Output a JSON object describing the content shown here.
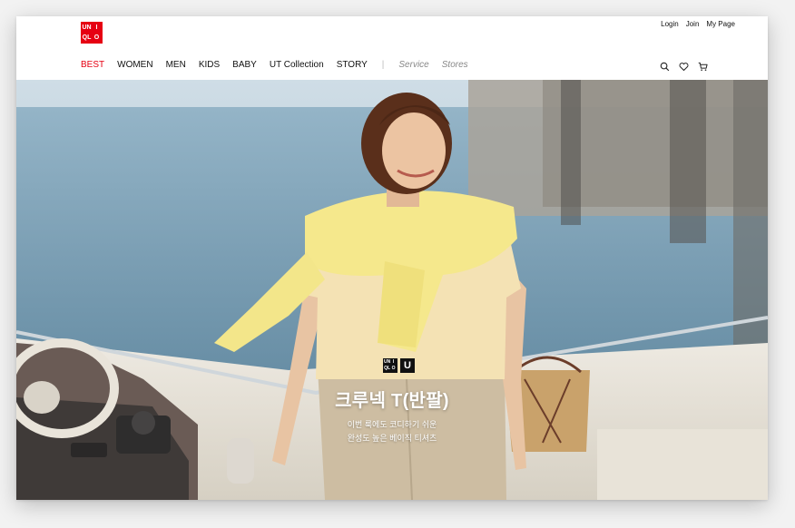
{
  "brand": {
    "logo_text": [
      "UNI",
      "QLO"
    ],
    "logo_cells": [
      "UN",
      "I",
      "QL",
      "O"
    ],
    "color": "#e60012"
  },
  "top_links": [
    "Login",
    "Join",
    "My Page"
  ],
  "nav": {
    "items": [
      "BEST",
      "WOMEN",
      "MEN",
      "KIDS",
      "BABY",
      "UT Collection",
      "STORY"
    ],
    "active": "BEST",
    "separator": "|",
    "secondary": [
      "Service",
      "Stores"
    ]
  },
  "icons": [
    "search-icon",
    "heart-icon",
    "cart-icon"
  ],
  "hero": {
    "logos": [
      "UNIQLO",
      "U"
    ],
    "title": "크루넥 T(반팔)",
    "subtitle_lines": [
      "이번 룩에도 코디하기 쉬운",
      "완성도 높은 베이직 티셔츠"
    ]
  }
}
